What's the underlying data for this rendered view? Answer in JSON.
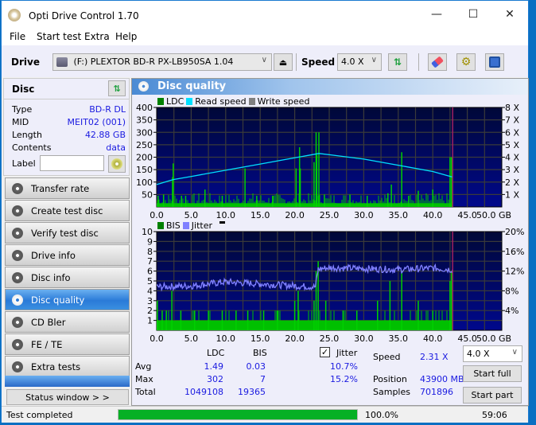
{
  "window": {
    "title": "Opti Drive Control 1.70",
    "controls": {
      "minimize": "—",
      "maximize": "☐",
      "close": "✕"
    }
  },
  "menu": [
    "File",
    "Start test",
    "Extra",
    "Help"
  ],
  "toolbar": {
    "drive_label": "Drive",
    "drive_value": "(F:)  PLEXTOR BD-R  PX-LB950SA 1.04",
    "speed_label": "Speed",
    "speed_value": "4.0 X",
    "icons": [
      "eject-icon",
      "refresh-icon",
      "eraser-icon",
      "settings-icon",
      "save-icon"
    ]
  },
  "disc": {
    "header": "Disc",
    "rows": [
      {
        "key": "Type",
        "value": "BD-R DL"
      },
      {
        "key": "MID",
        "value": "MEIT02 (001)"
      },
      {
        "key": "Length",
        "value": "42.88 GB"
      },
      {
        "key": "Contents",
        "value": "data"
      }
    ],
    "label_key": "Label",
    "label_value": ""
  },
  "nav": [
    {
      "label": "Transfer rate",
      "active": false
    },
    {
      "label": "Create test disc",
      "active": false
    },
    {
      "label": "Verify test disc",
      "active": false
    },
    {
      "label": "Drive info",
      "active": false
    },
    {
      "label": "Disc info",
      "active": false
    },
    {
      "label": "Disc quality",
      "active": true
    },
    {
      "label": "CD Bler",
      "active": false
    },
    {
      "label": "FE / TE",
      "active": false
    },
    {
      "label": "Extra tests",
      "active": false
    }
  ],
  "status_window_label": "Status window > >",
  "main": {
    "title": "Disc quality"
  },
  "colors": {
    "ldc": "#00c000",
    "read_speed": "#00e0ff",
    "write_speed": "#808080",
    "bis": "#00c000",
    "jitter": "#8080ff",
    "plot_bg": "#000080",
    "marker": "#a02060"
  },
  "chart_data": [
    {
      "type": "bar",
      "title": "LDC / Read speed",
      "legend": [
        "LDC",
        "Read speed",
        "Write speed"
      ],
      "legend_position": "top-left",
      "xlabel": "GB",
      "xlim": [
        0,
        50
      ],
      "x_ticks": [
        "0.0",
        "5.0",
        "10.0",
        "15.0",
        "20.0",
        "25.0",
        "30.0",
        "35.0",
        "40.0",
        "45.0",
        "50.0 GB"
      ],
      "ylim": [
        0,
        400
      ],
      "y_ticks": [
        "50",
        "100",
        "150",
        "200",
        "250",
        "300",
        "350",
        "400"
      ],
      "y2lim": [
        0,
        8
      ],
      "y2_ticks": [
        "1 X",
        "2 X",
        "3 X",
        "4 X",
        "5 X",
        "6 X",
        "7 X",
        "8 X"
      ],
      "end_marker_gb": 42.88,
      "ldc_spikes": [
        [
          0.2,
          45
        ],
        [
          1.0,
          50
        ],
        [
          2.3,
          120
        ],
        [
          2.4,
          175
        ],
        [
          3.6,
          45
        ],
        [
          4.2,
          45
        ],
        [
          7.0,
          70
        ],
        [
          9.5,
          45
        ],
        [
          12.8,
          155
        ],
        [
          14.5,
          45
        ],
        [
          16.8,
          45
        ],
        [
          20.2,
          155
        ],
        [
          20.7,
          240
        ],
        [
          20.8,
          155
        ],
        [
          22.8,
          180
        ],
        [
          23.1,
          300
        ],
        [
          23.2,
          210
        ],
        [
          23.5,
          300
        ],
        [
          24.3,
          50
        ],
        [
          28.0,
          50
        ],
        [
          30.5,
          45
        ],
        [
          33.5,
          55
        ],
        [
          34.0,
          90
        ],
        [
          35.5,
          220
        ],
        [
          36.5,
          45
        ],
        [
          37.9,
          65
        ],
        [
          40.0,
          70
        ],
        [
          42.5,
          200
        ],
        [
          42.7,
          200
        ]
      ],
      "ldc_baseline": 15,
      "read_speed": [
        [
          0,
          1.8
        ],
        [
          2.4,
          2.2
        ],
        [
          5,
          2.45
        ],
        [
          10,
          2.95
        ],
        [
          15,
          3.45
        ],
        [
          20,
          3.95
        ],
        [
          23.5,
          4.3
        ],
        [
          25,
          4.2
        ],
        [
          30,
          3.85
        ],
        [
          35,
          3.35
        ],
        [
          40,
          2.85
        ],
        [
          42.88,
          2.4
        ]
      ],
      "grid": true
    },
    {
      "type": "bar",
      "title": "BIS / Jitter",
      "legend": [
        "BIS",
        "Jitter"
      ],
      "legend_position": "top-left",
      "xlabel": "GB",
      "xlim": [
        0,
        50
      ],
      "x_ticks": [
        "0.0",
        "5.0",
        "10.0",
        "15.0",
        "20.0",
        "25.0",
        "30.0",
        "35.0",
        "40.0",
        "45.0",
        "50.0 GB"
      ],
      "ylim": [
        0,
        10
      ],
      "y_ticks": [
        "1",
        "2",
        "3",
        "4",
        "5",
        "6",
        "7",
        "8",
        "9",
        "10"
      ],
      "y2lim": [
        0,
        20
      ],
      "y2_ticks": [
        "4%",
        "8%",
        "12%",
        "16%",
        "20%"
      ],
      "end_marker_gb": 42.88,
      "bis_baseline": 1,
      "bis_spikes": [
        [
          0.1,
          3
        ],
        [
          0.8,
          2
        ],
        [
          1.4,
          2
        ],
        [
          2.2,
          4
        ],
        [
          3.5,
          2
        ],
        [
          5.5,
          2
        ],
        [
          7.5,
          2
        ],
        [
          9.5,
          2
        ],
        [
          11.5,
          2
        ],
        [
          13.2,
          2
        ],
        [
          15.5,
          2
        ],
        [
          17.5,
          2
        ],
        [
          20.0,
          3
        ],
        [
          20.5,
          4
        ],
        [
          22.8,
          3
        ],
        [
          23.1,
          6
        ],
        [
          23.4,
          7
        ],
        [
          24.5,
          3
        ],
        [
          27.0,
          2
        ],
        [
          29.0,
          2
        ],
        [
          32.0,
          3
        ],
        [
          33.8,
          5
        ],
        [
          35.5,
          6
        ],
        [
          37.9,
          3
        ],
        [
          40.0,
          2
        ],
        [
          42.5,
          5
        ],
        [
          42.7,
          6
        ]
      ],
      "jitter": [
        [
          0,
          8.8
        ],
        [
          5,
          9.0
        ],
        [
          10,
          9.8
        ],
        [
          15,
          9.4
        ],
        [
          20,
          9.0
        ],
        [
          23.0,
          8.8
        ],
        [
          23.4,
          12.4
        ],
        [
          25,
          12.7
        ],
        [
          30,
          12.5
        ],
        [
          35,
          12.3
        ],
        [
          40,
          12.6
        ],
        [
          42.88,
          12.3
        ]
      ],
      "grid": true
    }
  ],
  "stats": {
    "col_ldc": "LDC",
    "col_bis": "BIS",
    "jitter_label": "Jitter",
    "jitter_checked": true,
    "rows": [
      {
        "label": "Avg",
        "ldc": "1.49",
        "bis": "0.03",
        "jitter": "10.7%"
      },
      {
        "label": "Max",
        "ldc": "302",
        "bis": "7",
        "jitter": "15.2%"
      },
      {
        "label": "Total",
        "ldc": "1049108",
        "bis": "19365",
        "jitter": ""
      }
    ],
    "speed_label": "Speed",
    "speed_value": "2.31 X",
    "position_label": "Position",
    "position_value": "43900 MB",
    "samples_label": "Samples",
    "samples_value": "701896",
    "speed_select": "4.0 X",
    "start_full": "Start full",
    "start_part": "Start part"
  },
  "statusbar": {
    "text": "Test completed",
    "progress_pct": 100,
    "progress_text": "100.0%",
    "elapsed": "59:06"
  }
}
